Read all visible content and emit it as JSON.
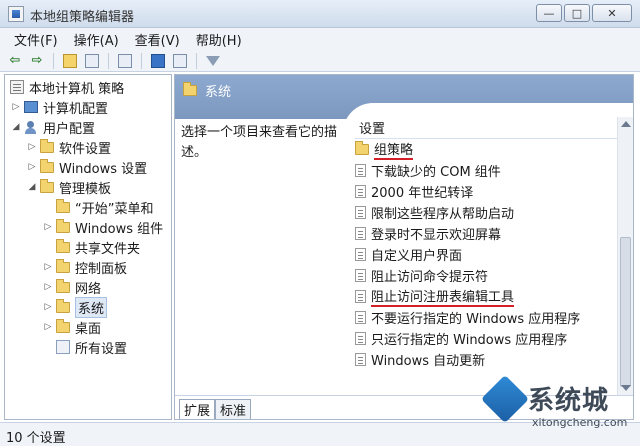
{
  "window": {
    "title": "本地组策略编辑器"
  },
  "menu": [
    "文件(F)",
    "操作(A)",
    "查看(V)",
    "帮助(H)"
  ],
  "tree": {
    "root": "本地计算机 策略",
    "items": [
      {
        "label": "计算机配置",
        "depth": 1,
        "icon": "computer-icon",
        "expand": "collapsed"
      },
      {
        "label": "用户配置",
        "depth": 1,
        "icon": "user-icon",
        "expand": "expanded"
      },
      {
        "label": "软件设置",
        "depth": 2,
        "icon": "folder-icon",
        "expand": "collapsed"
      },
      {
        "label": "Windows 设置",
        "depth": 2,
        "icon": "folder-icon",
        "expand": "collapsed"
      },
      {
        "label": "管理模板",
        "depth": 2,
        "icon": "folder-icon",
        "expand": "expanded"
      },
      {
        "label": "“开始”菜单和",
        "depth": 3,
        "icon": "folder-icon",
        "expand": "none"
      },
      {
        "label": "Windows 组件",
        "depth": 3,
        "icon": "folder-icon",
        "expand": "collapsed"
      },
      {
        "label": "共享文件夹",
        "depth": 3,
        "icon": "folder-icon",
        "expand": "none"
      },
      {
        "label": "控制面板",
        "depth": 3,
        "icon": "folder-icon",
        "expand": "collapsed"
      },
      {
        "label": "网络",
        "depth": 3,
        "icon": "folder-icon",
        "expand": "collapsed"
      },
      {
        "label": "系统",
        "depth": 3,
        "icon": "folder-icon",
        "expand": "collapsed",
        "selected": true
      },
      {
        "label": "桌面",
        "depth": 3,
        "icon": "folder-icon",
        "expand": "collapsed"
      },
      {
        "label": "所有设置",
        "depth": 3,
        "icon": "settings-icon",
        "expand": "none"
      }
    ]
  },
  "right": {
    "header_title": "系统",
    "description": "选择一个项目来查看它的描述。",
    "column_header": "设置",
    "rows": [
      {
        "label": "组策略",
        "icon": "folder-icon",
        "highlight": true
      },
      {
        "label": "下载缺少的 COM 组件",
        "icon": "policy-icon",
        "highlight": false
      },
      {
        "label": "2000 年世纪转译",
        "icon": "policy-icon",
        "highlight": false
      },
      {
        "label": "限制这些程序从帮助启动",
        "icon": "policy-icon",
        "highlight": false
      },
      {
        "label": "登录时不显示欢迎屏幕",
        "icon": "policy-icon",
        "highlight": false
      },
      {
        "label": "自定义用户界面",
        "icon": "policy-icon",
        "highlight": false
      },
      {
        "label": "阻止访问命令提示符",
        "icon": "policy-icon",
        "highlight": false
      },
      {
        "label": "阻止访问注册表编辑工具",
        "icon": "policy-icon",
        "highlight": true
      },
      {
        "label": "不要运行指定的 Windows 应用程序",
        "icon": "policy-icon",
        "highlight": false
      },
      {
        "label": "只运行指定的 Windows 应用程序",
        "icon": "policy-icon",
        "highlight": false
      },
      {
        "label": "Windows 自动更新",
        "icon": "policy-icon",
        "highlight": false
      }
    ],
    "tabs": [
      "扩展",
      "标准"
    ]
  },
  "status": {
    "text": "10 个设置"
  },
  "watermark": {
    "brand": "系统城",
    "url": "xitongcheng.com"
  },
  "colors": {
    "header": "#8da9cf",
    "highlight_underline": "#d21f28"
  }
}
